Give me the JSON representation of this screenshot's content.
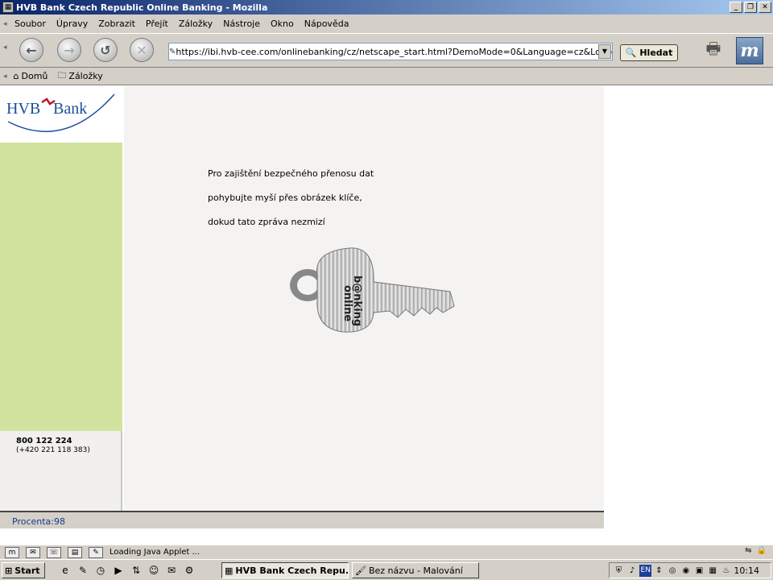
{
  "window": {
    "title": "HVB Bank Czech Republic Online Banking - Mozilla",
    "buttons": {
      "minimize": "_",
      "maximize": "❐",
      "close": "✕"
    }
  },
  "menu": [
    "Soubor",
    "Úpravy",
    "Zobrazit",
    "Přejít",
    "Záložky",
    "Nástroje",
    "Okno",
    "Nápověda"
  ],
  "nav": {
    "url": "https://ibi.hvb-cee.com/onlinebanking/cz/netscape_start.html?DemoMode=0&Language=cz&LogLevel=50",
    "search_label": "Hledat",
    "icons": [
      "back-icon",
      "forward-icon",
      "reload-icon",
      "stop-icon",
      "print-icon"
    ]
  },
  "personal_bar": {
    "home": "Domů",
    "bookmarks": "Záložky"
  },
  "page": {
    "logo": {
      "left": "HVB",
      "right": "Bank"
    },
    "message": [
      "Pro zajištění bezpečného přenosu dat",
      "pohybujte myší přes obrázek klíče,",
      "dokud tato zpráva nezmizí"
    ],
    "key_text": {
      "line1": "online",
      "line2": "b@nking"
    },
    "phone": {
      "main": "800 122 224",
      "alt": "(+420 221 118 383)"
    },
    "status": "Procenta:98",
    "colors": {
      "green_band": "#d1e39f",
      "brand_red": "#c0142a",
      "brand_blue": "#1d4f9a"
    }
  },
  "moz_status": {
    "text": "Loading Java Applet ..."
  },
  "taskbar": {
    "start": "Start",
    "tasks": [
      {
        "label": "HVB Bank Czech Repu...",
        "active": true
      },
      {
        "label": "Bez názvu - Malování",
        "active": false
      }
    ],
    "lang": "EN",
    "clock": "10:14"
  }
}
